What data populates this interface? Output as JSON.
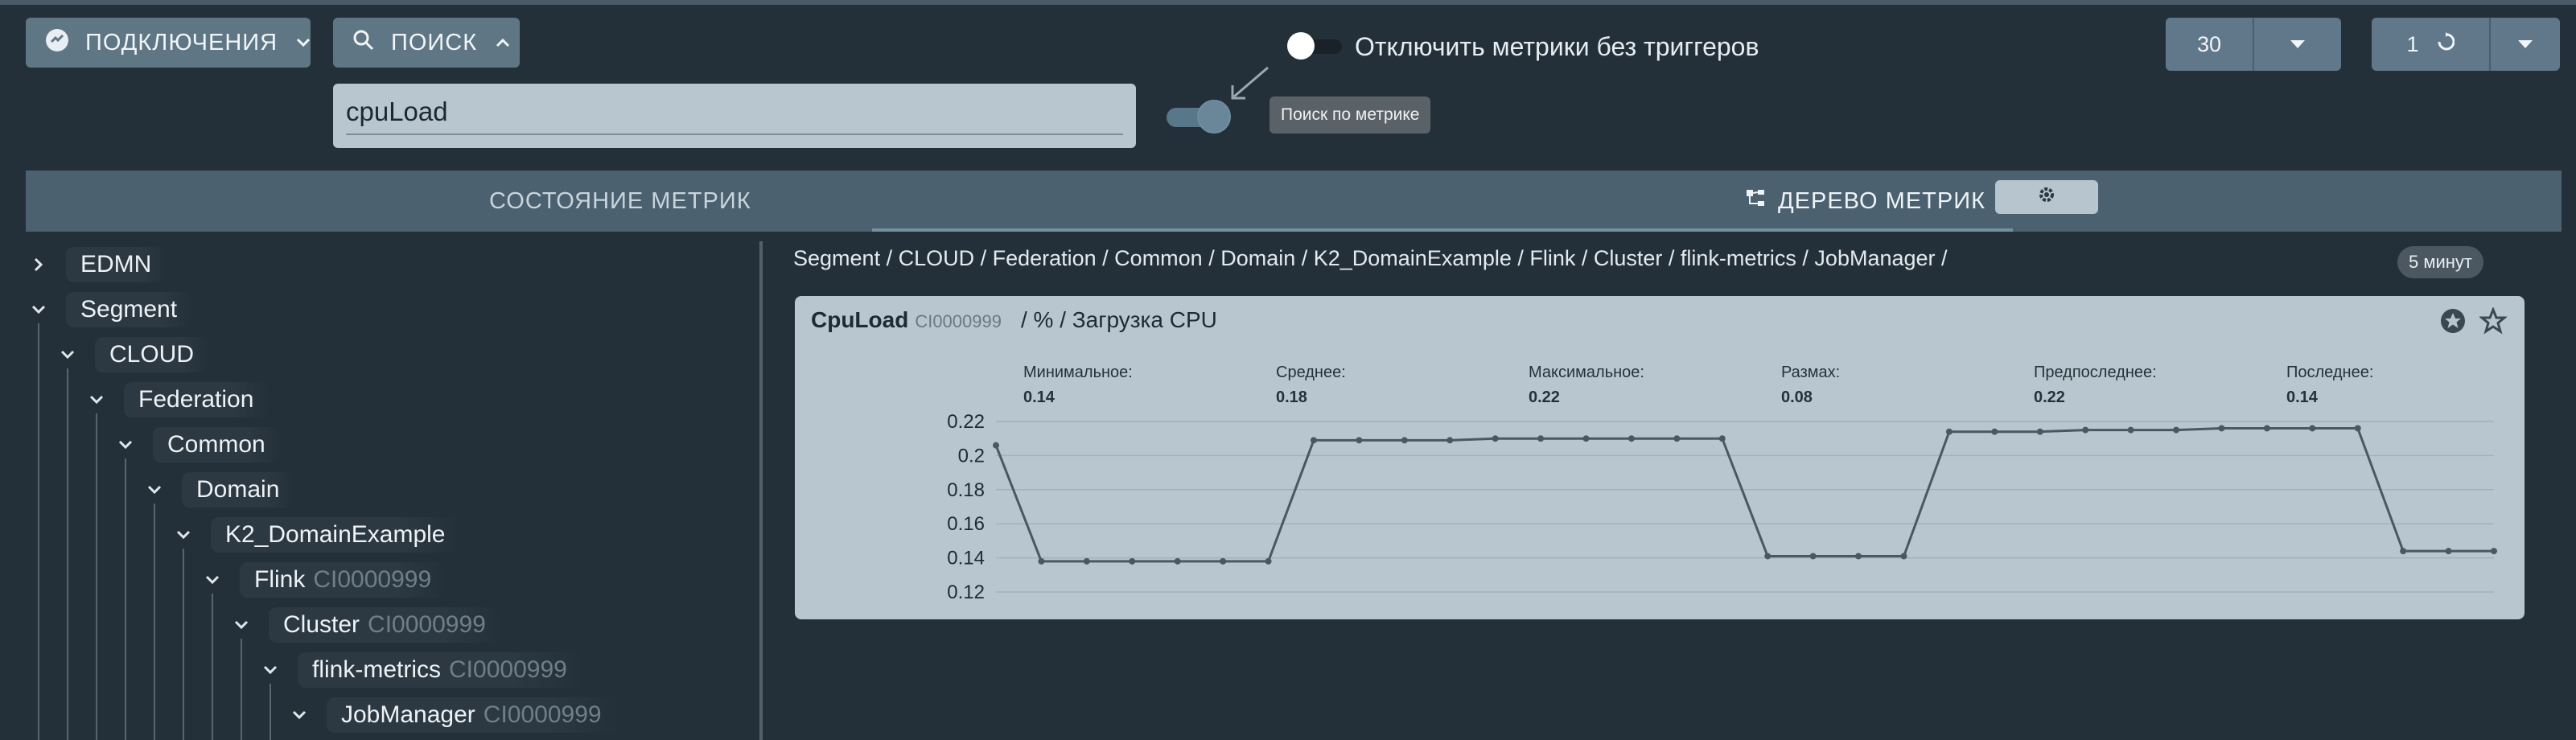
{
  "toolbar": {
    "connections_label": "ПОДКЛЮЧЕНИЯ",
    "search_label": "ПОИСК",
    "search_value": "cpuLoad",
    "disable_metrics_label": "Отключить метрики без триггеров",
    "metric_search_tooltip": "Поиск по метрике",
    "count_value": "30",
    "refresh_value": "1"
  },
  "tabs": {
    "state_label": "СОСТОЯНИЕ МЕТРИК",
    "tree_label": "ДЕРЕВО МЕТРИК"
  },
  "tree": [
    {
      "label": "EDMN",
      "ci": "",
      "expanded": false,
      "depth": 0
    },
    {
      "label": "Segment",
      "ci": "",
      "expanded": true,
      "depth": 0
    },
    {
      "label": "CLOUD",
      "ci": "",
      "expanded": true,
      "depth": 1
    },
    {
      "label": "Federation",
      "ci": "",
      "expanded": true,
      "depth": 2
    },
    {
      "label": "Common",
      "ci": "",
      "expanded": true,
      "depth": 3
    },
    {
      "label": "Domain",
      "ci": "",
      "expanded": true,
      "depth": 4
    },
    {
      "label": "K2_DomainExample",
      "ci": "",
      "expanded": true,
      "depth": 5
    },
    {
      "label": "Flink",
      "ci": "CI0000999",
      "expanded": true,
      "depth": 6
    },
    {
      "label": "Cluster",
      "ci": "CI0000999",
      "expanded": true,
      "depth": 7
    },
    {
      "label": "flink-metrics",
      "ci": "CI0000999",
      "expanded": true,
      "depth": 8
    },
    {
      "label": "JobManager",
      "ci": "CI0000999",
      "expanded": true,
      "depth": 9
    }
  ],
  "breadcrumb": "Segment / CLOUD / Federation / Common / Domain / K2_DomainExample / Flink / Cluster / flink-metrics / JobManager /",
  "time_badge": "5 минут",
  "card": {
    "name": "CpuLoad",
    "ci": "CI0000999",
    "unit": "/ % / Загрузка CPU",
    "stats": [
      {
        "label": "Минимальное:",
        "value": "0.14"
      },
      {
        "label": "Среднее:",
        "value": "0.18"
      },
      {
        "label": "Максимальное:",
        "value": "0.22"
      },
      {
        "label": "Размах:",
        "value": "0.08"
      },
      {
        "label": "Предпоследнее:",
        "value": "0.22"
      },
      {
        "label": "Последнее:",
        "value": "0.14"
      }
    ]
  },
  "chart_data": {
    "type": "line",
    "title": "",
    "xlabel": "",
    "ylabel": "",
    "ylim": [
      0.12,
      0.22
    ],
    "yticks": [
      "0.22",
      "0.2",
      "0.18",
      "0.16",
      "0.14",
      "0.12"
    ],
    "grid": true,
    "x": [
      0,
      1,
      2,
      3,
      4,
      5,
      6,
      7,
      8,
      9,
      10,
      11,
      12,
      13,
      14,
      15,
      16,
      17,
      18,
      19,
      20,
      21,
      22,
      23,
      24,
      25,
      26,
      27,
      28,
      29,
      30,
      31,
      32,
      33
    ],
    "series": [
      {
        "name": "",
        "values": [
          0.206,
          0.138,
          0.138,
          0.138,
          0.138,
          0.138,
          0.138,
          0.209,
          0.209,
          0.209,
          0.209,
          0.21,
          0.21,
          0.21,
          0.21,
          0.21,
          0.21,
          0.141,
          0.141,
          0.141,
          0.141,
          0.214,
          0.214,
          0.214,
          0.215,
          0.215,
          0.215,
          0.216,
          0.216,
          0.216,
          0.216,
          0.144,
          0.144,
          0.144
        ]
      }
    ]
  },
  "colors": {
    "background": "#243039",
    "card": "#b8c7cf",
    "accent": "#60788a",
    "line": "#4a5860"
  }
}
